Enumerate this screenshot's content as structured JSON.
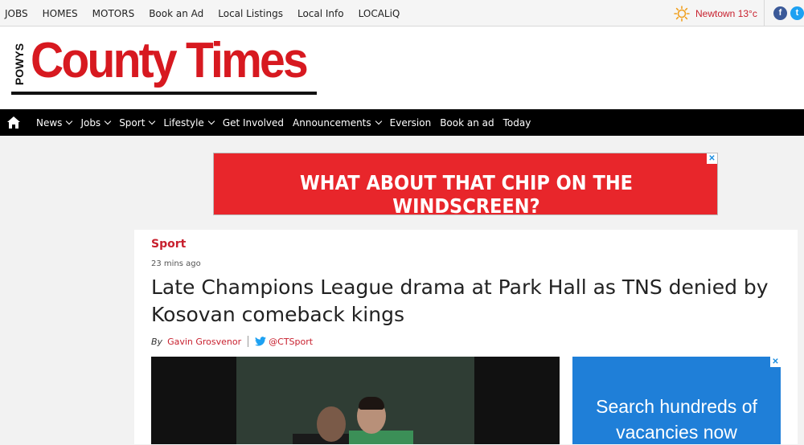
{
  "topbar": {
    "links": [
      "JOBS",
      "HOMES",
      "MOTORS",
      "Book an Ad",
      "Local Listings",
      "Local Info",
      "LOCALiQ"
    ],
    "weather": "Newtown 13°c",
    "social": {
      "facebook_icon": "f",
      "twitter_icon": "t"
    }
  },
  "masthead": {
    "kicker": "POWYS",
    "title": "County Times"
  },
  "nav": {
    "items": [
      {
        "label": "News",
        "dropdown": true
      },
      {
        "label": "Jobs",
        "dropdown": true
      },
      {
        "label": "Sport",
        "dropdown": true
      },
      {
        "label": "Lifestyle",
        "dropdown": true
      },
      {
        "label": "Get Involved",
        "dropdown": false
      },
      {
        "label": "Announcements",
        "dropdown": true
      },
      {
        "label": "Eversion",
        "dropdown": false
      },
      {
        "label": "Book an ad",
        "dropdown": false
      },
      {
        "label": "Today",
        "dropdown": false
      }
    ]
  },
  "banner_ad": {
    "text": "WHAT ABOUT THAT CHIP ON THE WINDSCREEN?",
    "close": "✕"
  },
  "article": {
    "section": "Sport",
    "time": "23 mins ago",
    "headline": "Late Champions League drama at Park Hall as TNS denied by Kosovan comeback kings",
    "by": "By",
    "author": "Gavin Grosvenor",
    "twitter_handle": "@CTSport"
  },
  "side_ad": {
    "text": "Search hundreds of vacancies now",
    "close": "✕"
  },
  "colors": {
    "brand_red": "#d71920",
    "link_red": "#c8202e",
    "nav_bg": "#000000",
    "job_ad_blue": "#1f7fd8"
  }
}
